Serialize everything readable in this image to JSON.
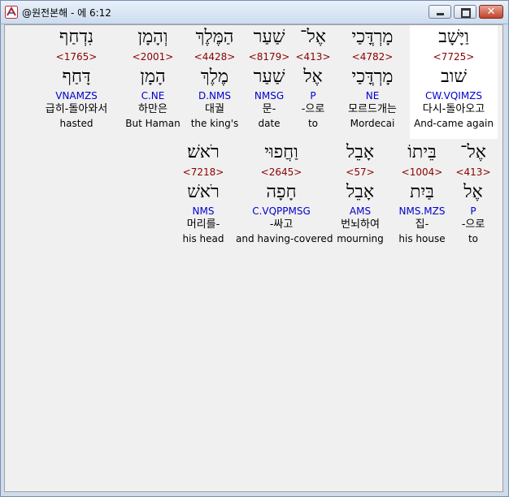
{
  "window": {
    "title": "@원전본해 - 에 6:12"
  },
  "rows": [
    [
      {
        "heb": "וַיָּשָׁב",
        "strong": "<7725>",
        "lemma": "שׁוב",
        "parse": "CW.VQIMZS",
        "korean": "다시-돌아오고",
        "english": "And-came again",
        "selected": true
      },
      {
        "heb": "מָרְדֳּכַי",
        "strong": "<4782>",
        "lemma": "מָרְדֳּכַי",
        "parse": "NE",
        "korean": "모르드개는",
        "english": "Mordecai"
      },
      {
        "heb": "אֶל־",
        "strong": "<413>",
        "lemma": "אֶל",
        "parse": "P",
        "korean": "-으로",
        "english": "to"
      },
      {
        "heb": "שַׁעַר",
        "strong": "<8179>",
        "lemma": "שַׁעַר",
        "parse": "NMSG",
        "korean": "문-",
        "english": "date"
      },
      {
        "heb": "הַמֶּלֶךְ",
        "strong": "<4428>",
        "lemma": "מֶלֶךְ",
        "parse": "D.NMS",
        "korean": "대궐",
        "english": "the king's"
      },
      {
        "heb": "וְהָמָן",
        "strong": "<2001>",
        "lemma": "הָמָן",
        "parse": "C.NE",
        "korean": "하만은",
        "english": "But Haman"
      },
      {
        "heb": "נִדְחַף",
        "strong": "<1765>",
        "lemma": "דָּחַף",
        "parse": "VNAMZS",
        "korean": "급히-돌아와서",
        "english": "hasted"
      }
    ],
    [
      {
        "heb": "אֶל־",
        "strong": "<413>",
        "lemma": "אֶל",
        "parse": "P",
        "korean": "-으로",
        "english": "to"
      },
      {
        "heb": "בֵּיתוֹ",
        "strong": "<1004>",
        "lemma": "בַּיִת",
        "parse": "NMS.MZS",
        "korean": "집-",
        "english": "his house"
      },
      {
        "heb": "אָבֵל",
        "strong": "<57>",
        "lemma": "אָבֵל",
        "parse": "AMS",
        "korean": "번뇌하여",
        "english": "mourning"
      },
      {
        "heb": "וַחֲפוּי",
        "strong": "<2645>",
        "lemma": "חָפָה",
        "parse": "C.VQPPMSG",
        "korean": "-싸고",
        "english": "and having-covered"
      },
      {
        "heb": "רֹאשׁ׃",
        "strong": "<7218>",
        "lemma": "רֹאשׁ",
        "parse": "NMS",
        "korean": "머리를-",
        "english": "his head"
      }
    ]
  ]
}
